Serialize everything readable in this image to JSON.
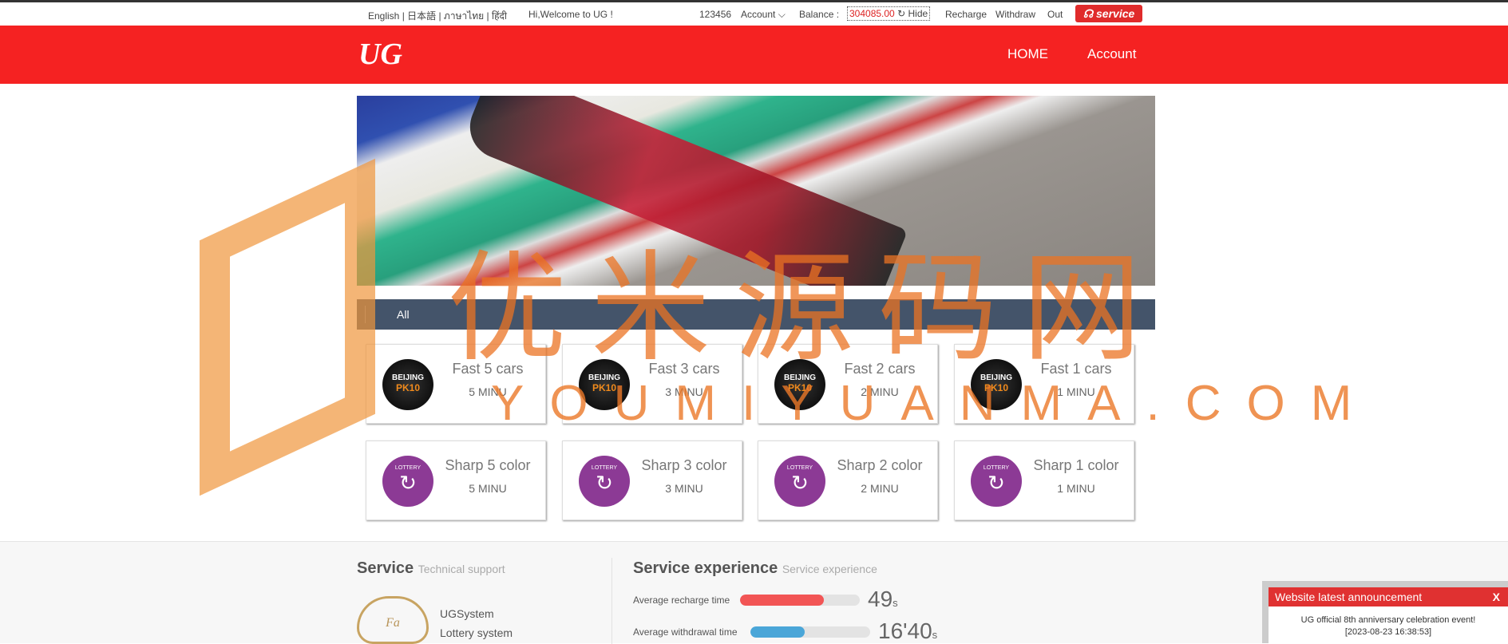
{
  "topbar": {
    "languages": "English | 日本語 | ภาษาไทย | हिंदी",
    "welcome": "Hi,Welcome to UG !",
    "user_id": "123456",
    "account": "Account",
    "balance_label": "Balance :",
    "balance_value": "304085.00",
    "hide": "Hide",
    "recharge": "Recharge",
    "withdraw": "Withdraw",
    "out": "Out",
    "service": "service"
  },
  "header": {
    "logo": "UG",
    "nav": [
      "HOME",
      "Account"
    ]
  },
  "tabs": {
    "all": "All"
  },
  "games": [
    {
      "title": "Fast 5 cars",
      "time": "5 MINU",
      "icon": "beijing-pk10-icon"
    },
    {
      "title": "Fast 3 cars",
      "time": "3 MINU",
      "icon": "beijing-pk10-icon"
    },
    {
      "title": "Fast 2 cars",
      "time": "2 MINU",
      "icon": "beijing-pk10-icon"
    },
    {
      "title": "Fast 1 cars",
      "time": "1 MINU",
      "icon": "beijing-pk10-icon"
    },
    {
      "title": "Sharp 5 color",
      "time": "5 MINU",
      "icon": "lottery-icon"
    },
    {
      "title": "Sharp 3 color",
      "time": "3 MINU",
      "icon": "lottery-icon"
    },
    {
      "title": "Sharp 2 color",
      "time": "2 MINU",
      "icon": "lottery-icon"
    },
    {
      "title": "Sharp 1 color",
      "time": "1 MINU",
      "icon": "lottery-icon"
    }
  ],
  "icon_text": {
    "beijing": "BEIJING",
    "pk10": "PK10",
    "lottery": "LOTTERY"
  },
  "footer": {
    "service_title": "Service",
    "service_sub": "Technical support",
    "cloud_logo": "Fa",
    "system": "UGSystem",
    "lottery_system": "Lottery system",
    "exp_title": "Service experience",
    "exp_sub": "Service experience",
    "recharge_label": "Average recharge time",
    "recharge_value": "49",
    "recharge_unit": "s",
    "recharge_fill": 0.7,
    "recharge_color": "#f25555",
    "withdraw_label": "Average withdrawal time",
    "withdraw_value": "16'40",
    "withdraw_unit": "s",
    "withdraw_fill": 0.45,
    "withdraw_color": "#4aa6d8"
  },
  "announcement": {
    "title": "Website latest announcement",
    "close": "X",
    "text": "UG official 8th anniversary celebration event!",
    "date": "[2023-08-23 16:38:53]"
  },
  "watermark": {
    "cn": "优米源码网",
    "en": "YOUMIYUANMA.COM"
  },
  "colors": {
    "brand_red": "#f52222",
    "tab_bar": "#44546a"
  }
}
